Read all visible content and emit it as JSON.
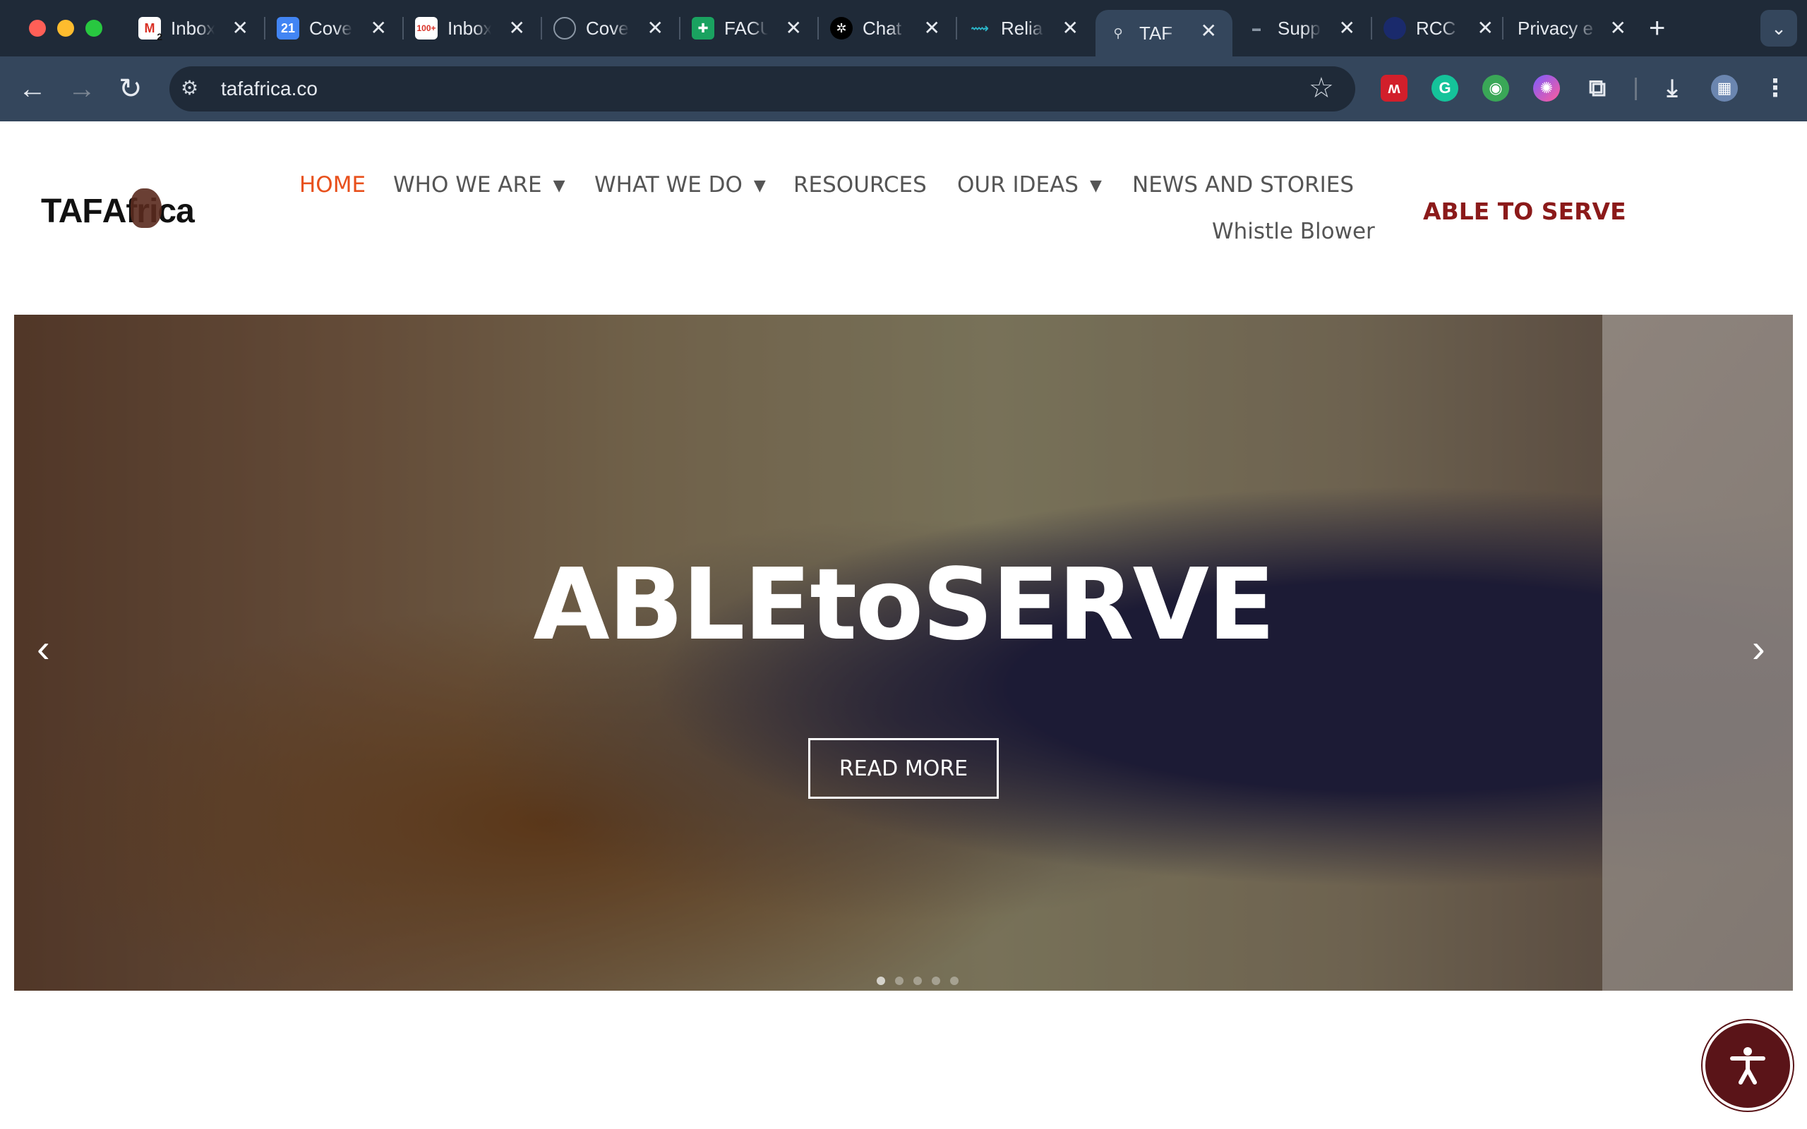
{
  "browser": {
    "tabs": [
      {
        "title": "Inbox",
        "icon": "gmail-icon",
        "color": "#ffffff"
      },
      {
        "title": "Cove",
        "icon": "google-calendar-icon",
        "color": "#4285f4"
      },
      {
        "title": "Inbox",
        "icon": "gmail-icon",
        "color": "#ffffff"
      },
      {
        "title": "Cove",
        "icon": "seal-icon",
        "color": "#2d3a48"
      },
      {
        "title": "FACU",
        "icon": "google-sheets-icon",
        "color": "#1aa260"
      },
      {
        "title": "Chat",
        "icon": "openai-icon",
        "color": "#000000"
      },
      {
        "title": "Relia",
        "icon": "reliance-icon",
        "color": "#2bb6c9"
      },
      {
        "title": "TAF",
        "icon": "taf-icon",
        "color": "#34465c"
      },
      {
        "title": "Supp",
        "icon": "support-icon",
        "color": "#2d3a48"
      },
      {
        "title": "RCC",
        "icon": "rcc-icon",
        "color": "#1a2a6c"
      },
      {
        "title": "Privacy e",
        "icon": "",
        "color": ""
      }
    ],
    "active_tab_index": 7,
    "new_tab_label": "+",
    "tab_menu_label": "⌄",
    "url": "tafafrica.co",
    "badges": {
      "gmail1": "2",
      "calendar": "21",
      "gmail2": "100+"
    }
  },
  "site": {
    "logo_text_left": "TAF",
    "logo_text_right": "frica",
    "logo_mid_letter": "A",
    "nav": {
      "home": "HOME",
      "who_we_are": "WHO WE ARE",
      "what_we_do": "WHAT WE DO",
      "resources": "RESOURCES",
      "our_ideas": "OUR IDEAS",
      "news": "NEWS AND STORIES",
      "whistle": "Whistle Blower",
      "able": "ABLE TO SERVE"
    },
    "hero": {
      "title": "ABLEtoSERVE",
      "button": "READ MORE",
      "prev": "‹",
      "next": "›"
    },
    "colors": {
      "accent": "#e8501c",
      "brand": "#8b1a1a",
      "access": "#5a1418"
    }
  }
}
